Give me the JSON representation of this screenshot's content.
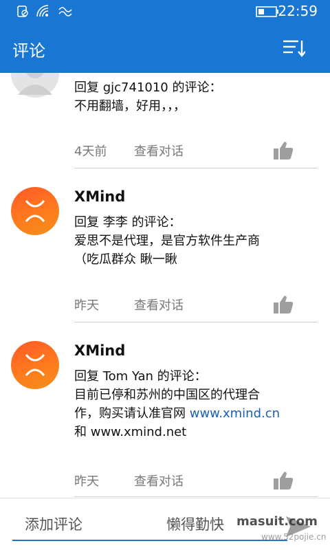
{
  "status": {
    "time": "22:59"
  },
  "appbar": {
    "title": "评论",
    "sort_icon": "sort-icon"
  },
  "comments": [
    {
      "reply_to": "回复 gjc741010 的评论：",
      "text": "不用翻墙，好用，，，",
      "time": "4天前",
      "conversation": "查看对话"
    },
    {
      "author": "XMind",
      "reply_to": "回复 李李 的评论：",
      "text_lines": [
        "爱思不是代理，是官方软件生产商",
        "（吃瓜群众 瞅一瞅"
      ],
      "time": "昨天",
      "conversation": "查看对话"
    },
    {
      "author": "XMind",
      "reply_to": "回复 Tom Yan 的评论：",
      "text_lines": [
        "目前已停和苏州的中国区的代理合",
        "作，购买请认准官网 ",
        "和 www.xmind.net"
      ],
      "link": "www.xmind.cn",
      "time": "昨天",
      "conversation": "查看对话"
    }
  ],
  "bottombar": {
    "placeholder": "添加评论",
    "placeholder_right": "懒得勤快"
  },
  "watermark": {
    "main": "masuit.com",
    "sub": "www.52pojie.cn"
  },
  "colors": {
    "accent": "#1976d2",
    "avatar": "#ff6a23",
    "link": "#1a5fb4"
  }
}
